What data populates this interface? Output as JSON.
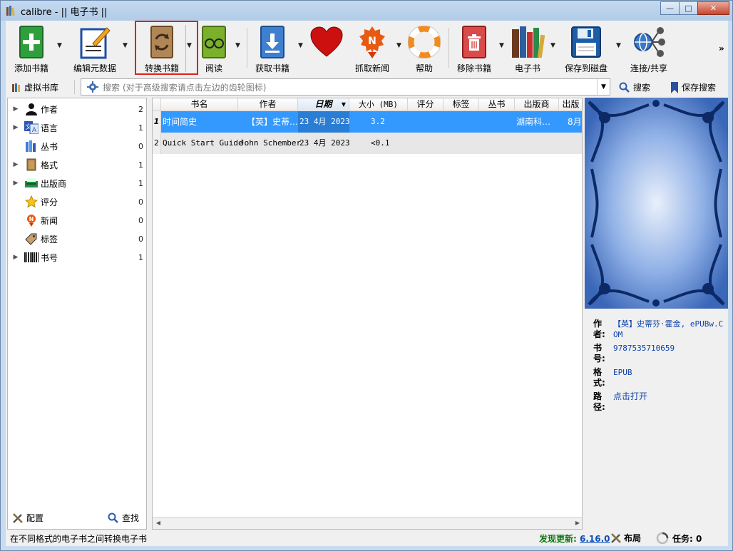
{
  "window": {
    "title": "calibre - || 电子书 ||",
    "buttons": [
      "minimize",
      "maximize",
      "close"
    ]
  },
  "toolbar": {
    "items": [
      {
        "label": "添加书籍",
        "icon": "add-book-icon",
        "has_menu": true
      },
      {
        "label": "编辑元数据",
        "icon": "edit-metadata-icon",
        "has_menu": true
      },
      {
        "label": "转换书籍",
        "icon": "convert-book-icon",
        "has_menu": true,
        "highlighted": true
      },
      {
        "label": "阅读",
        "icon": "read-book-icon",
        "has_menu": true
      },
      {
        "label": "获取书籍",
        "icon": "get-books-icon",
        "has_menu": true
      },
      {
        "label": "",
        "icon": "heart-icon",
        "has_menu": false
      },
      {
        "label": "抓取新闻",
        "icon": "fetch-news-icon",
        "has_menu": true
      },
      {
        "label": "帮助",
        "icon": "help-lifebuoy-icon",
        "has_menu": false
      },
      {
        "label": "移除书籍",
        "icon": "remove-book-icon",
        "has_menu": true
      },
      {
        "label": "电子书",
        "icon": "library-books-icon",
        "has_menu": true
      },
      {
        "label": "保存到磁盘",
        "icon": "save-disk-icon",
        "has_menu": true
      },
      {
        "label": "连接/共享",
        "icon": "connect-share-icon",
        "has_menu": false
      }
    ],
    "overflow": "»",
    "highlight_color": "#e0201a"
  },
  "searchbar": {
    "virtual_library": "虚拟书库",
    "search_label": "搜索",
    "placeholder": "(对于高级搜索请点击左边的齿轮图标)",
    "search_button": "搜索",
    "save_search_button": "保存搜索"
  },
  "tag_browser": {
    "items": [
      {
        "label": "作者",
        "count": "2",
        "expandable": true,
        "icon": "user-icon"
      },
      {
        "label": "语言",
        "count": "1",
        "expandable": true,
        "icon": "language-icon"
      },
      {
        "label": "丛书",
        "count": "0",
        "expandable": false,
        "icon": "series-icon"
      },
      {
        "label": "格式",
        "count": "1",
        "expandable": true,
        "icon": "format-book-icon"
      },
      {
        "label": "出版商",
        "count": "1",
        "expandable": true,
        "icon": "publisher-icon"
      },
      {
        "label": "评分",
        "count": "0",
        "expandable": false,
        "icon": "star-icon"
      },
      {
        "label": "新闻",
        "count": "0",
        "expandable": false,
        "icon": "news-icon"
      },
      {
        "label": "标签",
        "count": "0",
        "expandable": false,
        "icon": "tag-icon"
      },
      {
        "label": "书号",
        "count": "1",
        "expandable": true,
        "icon": "barcode-icon"
      }
    ],
    "configure": "配置",
    "find": "查找"
  },
  "book_table": {
    "columns": [
      "书名",
      "作者",
      "日期",
      "大小 (MB)",
      "评分",
      "标签",
      "丛书",
      "出版商",
      "出版"
    ],
    "sorted_column": "日期",
    "rows": [
      {
        "num": "1",
        "title": "时间简史",
        "author": "【英】史蒂…",
        "date": "23 4月 2023",
        "size": "3.2",
        "rating": "",
        "tags": "",
        "series": "",
        "publisher": "湖南科…",
        "pubdate": "8月",
        "selected": true
      },
      {
        "num": "2",
        "title": "Quick Start Guide",
        "author": "John Schember",
        "date": "23 4月 2023",
        "size": "<0.1",
        "rating": "",
        "tags": "",
        "series": "",
        "publisher": "",
        "pubdate": "",
        "selected": false
      }
    ]
  },
  "details": {
    "author_key": "作者:",
    "author_val": "【英】史蒂芬·霍金, ePUBw.COM",
    "isbn_key": "书号:",
    "isbn_val": "9787535710659",
    "format_key": "格式:",
    "format_val": "EPUB",
    "path_key": "路径:",
    "path_val": "点击打开"
  },
  "statusbar": {
    "message": "在不同格式的电子书之间转换电子书",
    "update_label": "发现更新:",
    "update_version": "6.16.0",
    "layout": "布局",
    "jobs": "任务: 0"
  }
}
